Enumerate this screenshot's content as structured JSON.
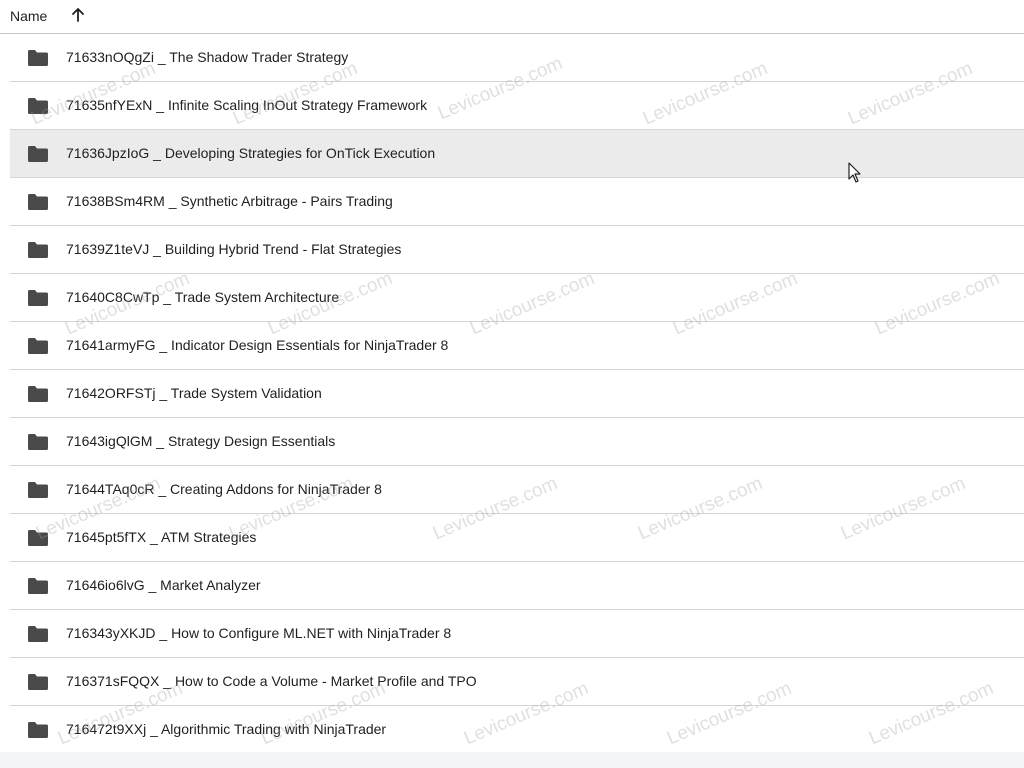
{
  "header": {
    "name_label": "Name"
  },
  "icons": {
    "sort": "arrow-up-icon",
    "folder": "folder-icon",
    "cursor": "mouse-pointer-icon"
  },
  "colors": {
    "folder": "#4a4a4a",
    "row_hover": "#ebebeb",
    "divider": "#d6d6d6"
  },
  "watermark_text": "Levicourse.com",
  "rows": [
    {
      "label": "71633nOQgZi _ The Shadow Trader Strategy"
    },
    {
      "label": "71635nfYExN _ Infinite Scaling InOut Strategy Framework"
    },
    {
      "label": "71636JpzIoG _ Developing Strategies for OnTick Execution",
      "hovered": true
    },
    {
      "label": "71638BSm4RM _ Synthetic Arbitrage - Pairs Trading"
    },
    {
      "label": "71639Z1teVJ _ Building Hybrid Trend - Flat Strategies"
    },
    {
      "label": "71640C8CwTp _ Trade System Architecture"
    },
    {
      "label": "71641armyFG _ Indicator Design Essentials for NinjaTrader 8"
    },
    {
      "label": "71642ORFSTj _ Trade System Validation"
    },
    {
      "label": "71643igQlGM _ Strategy Design Essentials"
    },
    {
      "label": "71644TAq0cR _ Creating Addons for NinjaTrader 8"
    },
    {
      "label": "71645pt5fTX _ ATM Strategies"
    },
    {
      "label": "71646io6lvG _ Market Analyzer"
    },
    {
      "label": "716343yXKJD _ How to Configure ML.NET with NinjaTrader 8"
    },
    {
      "label": "716371sFQQX _ How to Code a Volume - Market Profile and TPO"
    },
    {
      "label": "716472t9XXj _ Algorithmic Trading with NinjaTrader"
    }
  ]
}
